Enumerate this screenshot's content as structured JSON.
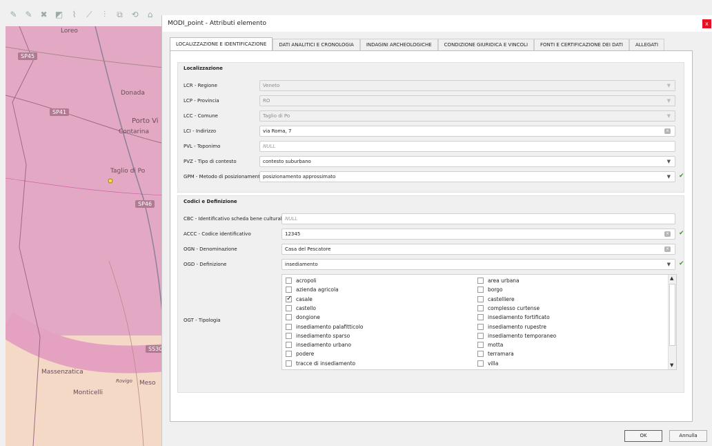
{
  "dialog": {
    "title": "MODI_point - Attributi elemento",
    "close_glyph": "x",
    "ok_label": "OK",
    "cancel_label": "Annulla"
  },
  "tabs": [
    {
      "label": "LOCALIZZAZIONE E IDENTIFICAZIONE",
      "active": true
    },
    {
      "label": "DATI ANALITICI E CRONOLOGIA"
    },
    {
      "label": "INDAGINI ARCHEOLOGICHE"
    },
    {
      "label": "CONDIZIONE GIURIDICA E VINCOLI"
    },
    {
      "label": "FONTI E CERTIFICAZIONE DEI DATI"
    },
    {
      "label": "ALLEGATI"
    }
  ],
  "localizzazione": {
    "heading": "Localizzazione",
    "lcr_label": "LCR - Regione",
    "lcr_value": "Veneto",
    "lcp_label": "LCP - Provincia",
    "lcp_value": "RO",
    "lcc_label": "LCC - Comune",
    "lcc_value": "Taglio di Po",
    "lci_label": "LCI - Indirizzo",
    "lci_value": "via Roma, 7",
    "pvl_label": "PVL - Toponimo",
    "pvl_value": "NULL",
    "pvz_label": "PVZ - Tipo di contesto",
    "pvz_value": "contesto suburbano",
    "gpm_label": "GPM - Metodo di posizionamento",
    "gpm_value": "posizionamento approssimato"
  },
  "codici": {
    "heading": "Codici e Definizione",
    "cbc_label": "CBC - Identificativo scheda bene culturale",
    "cbc_value": "NULL",
    "accc_label": "ACCC - Codice identificativo",
    "accc_value": "12345",
    "ogn_label": "OGN - Denominazione",
    "ogn_value": "Casa del Pescatore",
    "ogd_label": "OGD - Definizione",
    "ogd_value": "insediamento",
    "ogt_label": "OGT - Tipologia",
    "ogt_left": [
      {
        "label": "acropoli",
        "checked": false
      },
      {
        "label": "azienda agricola",
        "checked": false
      },
      {
        "label": "casale",
        "checked": true
      },
      {
        "label": "castello",
        "checked": false
      },
      {
        "label": "dongione",
        "checked": false
      },
      {
        "label": "insediamento palafitticolo",
        "checked": false
      },
      {
        "label": "insediamento sparso",
        "checked": false
      },
      {
        "label": "insediamento urbano",
        "checked": false
      },
      {
        "label": "podere",
        "checked": false
      },
      {
        "label": "tracce di insediamento",
        "checked": false
      }
    ],
    "ogt_right": [
      {
        "label": "area urbana",
        "checked": false
      },
      {
        "label": "borgo",
        "checked": false
      },
      {
        "label": "castelliere",
        "checked": false
      },
      {
        "label": "complesso curtense",
        "checked": false
      },
      {
        "label": "insediamento fortificato",
        "checked": false
      },
      {
        "label": "insediamento rupestre",
        "checked": false
      },
      {
        "label": "insediamento temporaneo",
        "checked": false
      },
      {
        "label": "motta",
        "checked": false
      },
      {
        "label": "terramara",
        "checked": false
      },
      {
        "label": "villa",
        "checked": false
      }
    ]
  },
  "map": {
    "labels": [
      "Loreo",
      "Donada",
      "Porto Vi",
      "Contarina",
      "Taglio di Po",
      "Rovigo",
      "Massenzatica",
      "Meso",
      "Monticelli"
    ],
    "roads": [
      "SP45",
      "SP41",
      "SP46",
      "SS30"
    ]
  },
  "colors": {
    "map_fill": "#e3a9c4",
    "check_green": "#3a9a22",
    "close_red": "#e81123"
  }
}
